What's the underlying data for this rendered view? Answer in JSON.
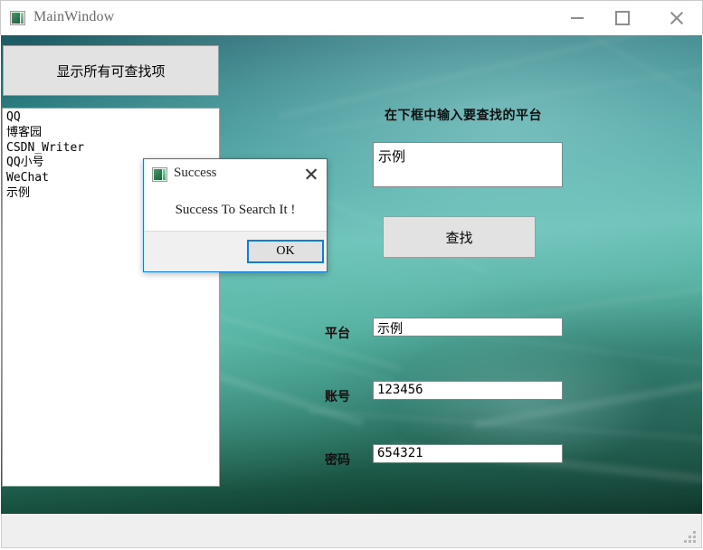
{
  "window": {
    "title": "MainWindow",
    "icon": "app-window-icon",
    "controls": {
      "minimize": "minimize-icon",
      "maximize": "maximize-icon",
      "close": "close-icon"
    }
  },
  "left_panel": {
    "show_all_button": "显示所有可查找项",
    "list_items": [
      "QQ",
      "博客园",
      "CSDN_Writer",
      "QQ小号",
      "WeChat",
      "示例"
    ]
  },
  "right_panel": {
    "header_label": "在下框中输入要查找的平台",
    "search_input_value": "示例",
    "search_button": "查找",
    "fields": [
      {
        "label": "平台",
        "value": "示例"
      },
      {
        "label": "账号",
        "value": "123456"
      },
      {
        "label": "密码",
        "value": "654321"
      }
    ]
  },
  "dialog": {
    "title": "Success",
    "icon": "app-window-icon",
    "message": "Success To Search It !",
    "ok_button": "OK",
    "close": "close-icon",
    "accent_color": "#0a7fe0"
  },
  "colors": {
    "background_teal": "#3f9c99",
    "button_face": "#e2e2e2",
    "statusbar": "#efefef"
  }
}
